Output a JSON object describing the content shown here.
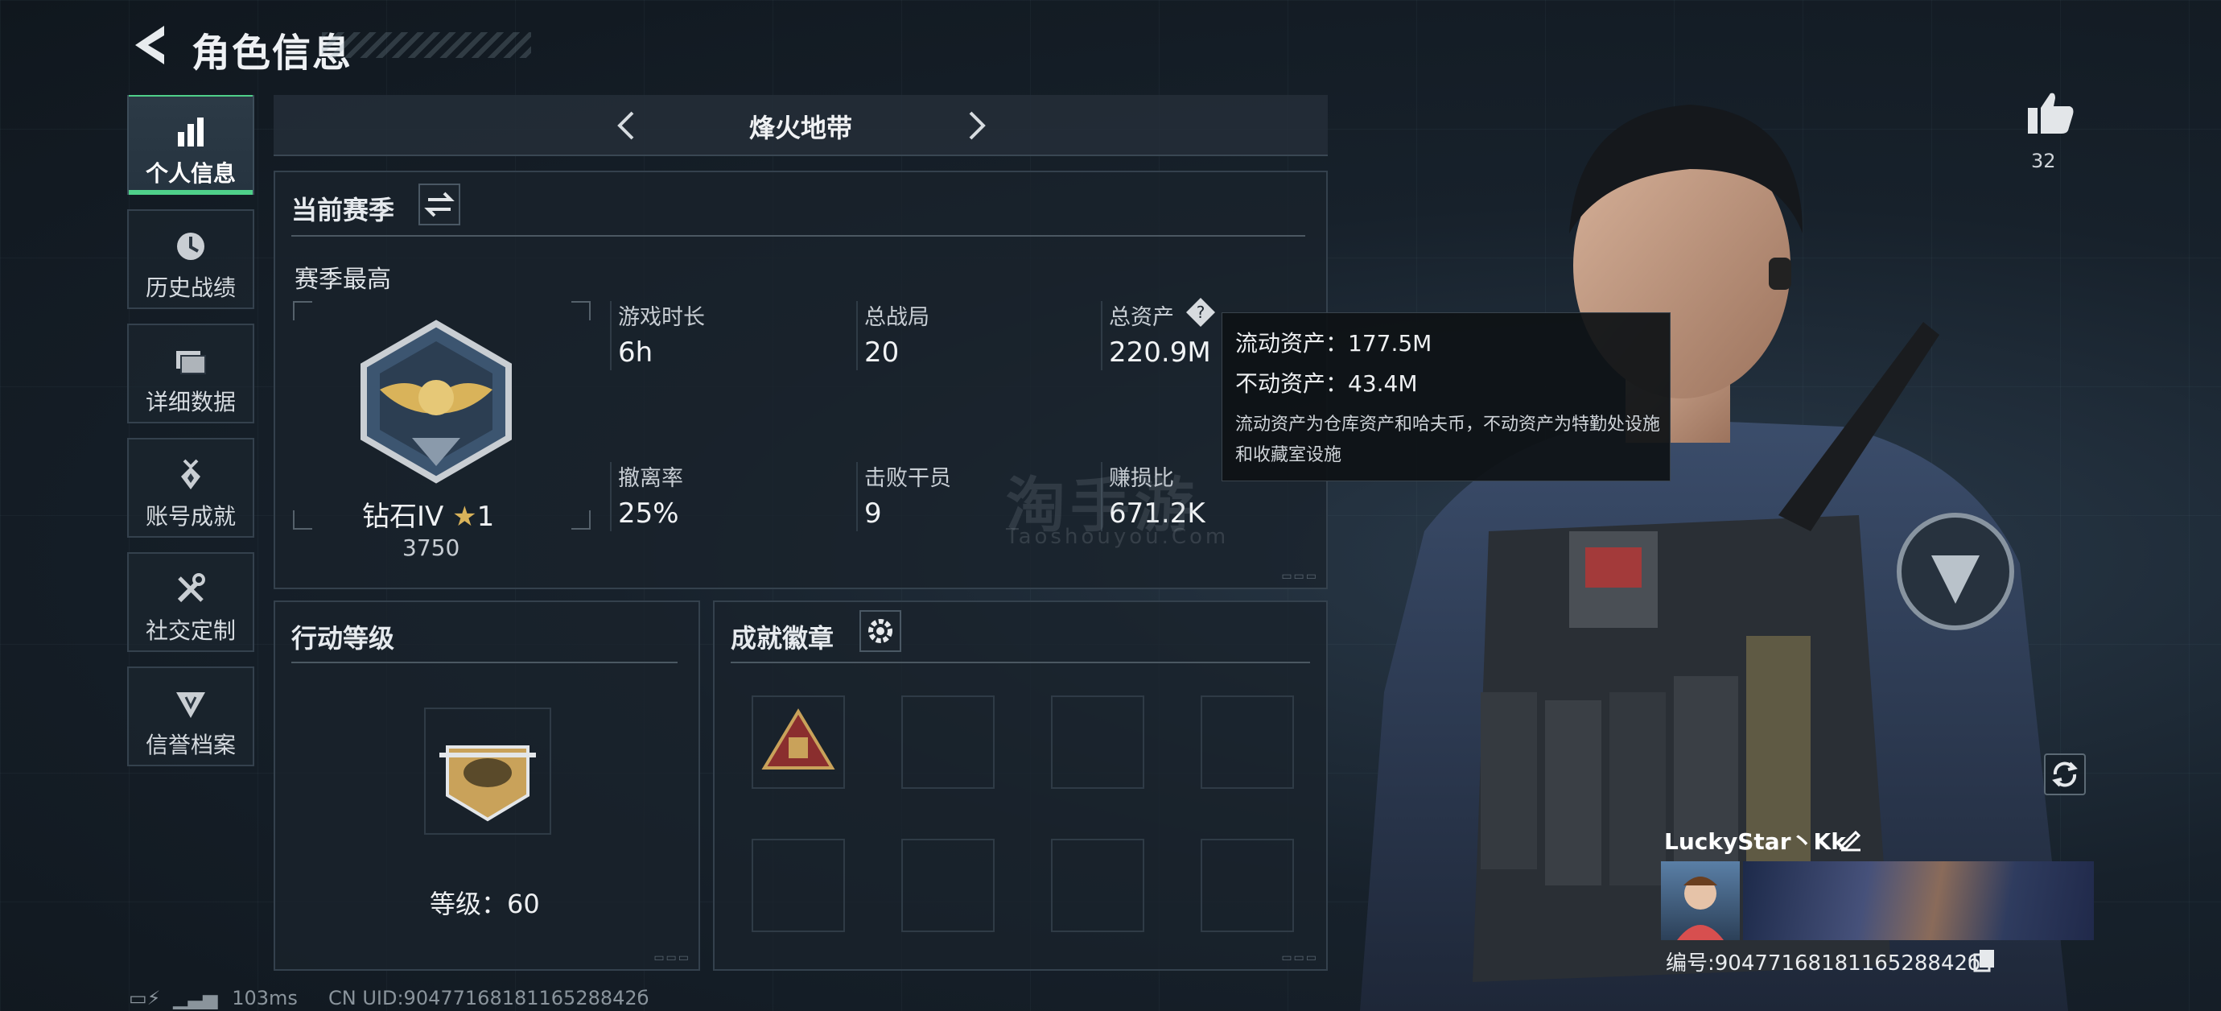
{
  "header": {
    "title": "角色信息"
  },
  "sidebar": {
    "items": [
      {
        "label": "个人信息",
        "icon": "bar-chart-icon",
        "active": true
      },
      {
        "label": "历史战绩",
        "icon": "history-clock-icon"
      },
      {
        "label": "详细数据",
        "icon": "folder-icon"
      },
      {
        "label": "账号成就",
        "icon": "medal-icon"
      },
      {
        "label": "社交定制",
        "icon": "tools-icon"
      },
      {
        "label": "信誉档案",
        "icon": "reputation-icon"
      }
    ]
  },
  "mode": {
    "title": "烽火地带"
  },
  "season": {
    "title": "当前赛季",
    "best_label": "赛季最高",
    "rank_name": "钻石IV",
    "rank_stars": "1",
    "rank_score": "3750",
    "stats": [
      {
        "label": "游戏时长",
        "value": "6h"
      },
      {
        "label": "总战局",
        "value": "20"
      },
      {
        "label": "总资产",
        "value": "220.9M"
      },
      {
        "label": "撤离率",
        "value": "25%"
      },
      {
        "label": "击败干员",
        "value": "9"
      },
      {
        "label": "赚损比",
        "value": "671.2K"
      }
    ]
  },
  "tooltip": {
    "liquid": "流动资产：177.5M",
    "fixed": "不动资产：43.4M",
    "note": "流动资产为仓库资产和哈夫币，不动资产为特勤处设施和收藏室设施"
  },
  "action_level": {
    "title": "行动等级",
    "level_text": "等级：60"
  },
  "achievements": {
    "title": "成就徽章"
  },
  "like": {
    "count": "32"
  },
  "player": {
    "name": "LuckyStar丶Kk",
    "id_text": "编号:9047716818116528842б"
  },
  "status": {
    "ping": "103ms",
    "uid": "CN UID:9047716818116528842б"
  },
  "watermark": {
    "main": "淘手游",
    "sub": "Taoshouyou.Com"
  }
}
